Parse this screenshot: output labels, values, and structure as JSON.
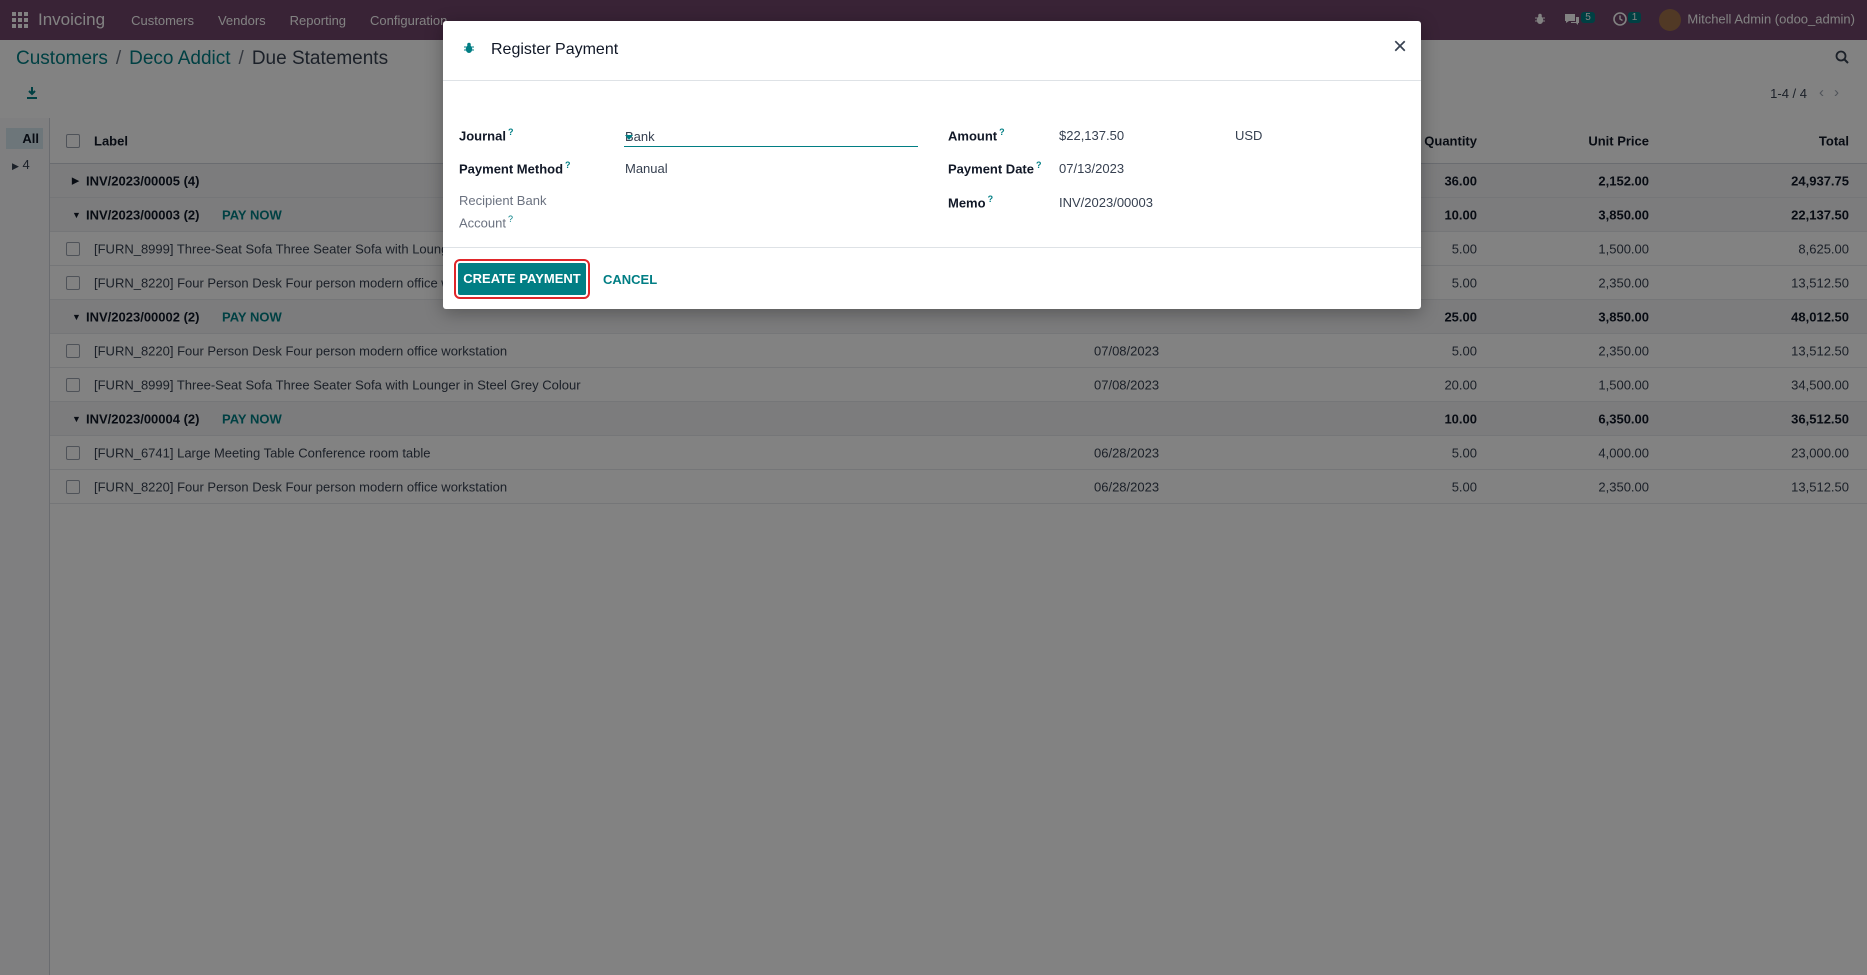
{
  "navbar": {
    "app_name": "Invoicing",
    "menu": [
      "Customers",
      "Vendors",
      "Reporting",
      "Configuration"
    ],
    "messages_count": "5",
    "activities_count": "1",
    "user": "Mitchell Admin (odoo_admin)"
  },
  "breadcrumb": {
    "items": [
      "Customers",
      "Deco Addict"
    ],
    "current": "Due Statements"
  },
  "pager": {
    "text": "1-4 / 4"
  },
  "side_panel": {
    "all_label": "All",
    "count_label": "4"
  },
  "list": {
    "headers": {
      "label": "Label",
      "quantity": "Quantity",
      "unit_price": "Unit Price",
      "total": "Total"
    },
    "rows": [
      {
        "type": "group",
        "expanded": false,
        "label": "INV/2023/00005 (4)",
        "pay": "",
        "date": "",
        "qty": "36.00",
        "unit": "2,152.00",
        "total": "24,937.75"
      },
      {
        "type": "group",
        "expanded": true,
        "label": "INV/2023/00003 (2)",
        "pay": "PAY NOW",
        "date": "",
        "qty": "10.00",
        "unit": "3,850.00",
        "total": "22,137.50"
      },
      {
        "type": "line",
        "label": "[FURN_8999] Three-Seat Sofa Three Seater Sofa with Lounger in Steel Grey Colour",
        "date": "",
        "qty": "5.00",
        "unit": "1,500.00",
        "total": "8,625.00"
      },
      {
        "type": "line",
        "label": "[FURN_8220] Four Person Desk Four person modern office workstation",
        "date": "",
        "qty": "5.00",
        "unit": "2,350.00",
        "total": "13,512.50"
      },
      {
        "type": "group",
        "expanded": true,
        "label": "INV/2023/00002 (2)",
        "pay": "PAY NOW",
        "date": "",
        "qty": "25.00",
        "unit": "3,850.00",
        "total": "48,012.50"
      },
      {
        "type": "line",
        "label": "[FURN_8220] Four Person Desk Four person modern office workstation",
        "date": "07/08/2023",
        "qty": "5.00",
        "unit": "2,350.00",
        "total": "13,512.50"
      },
      {
        "type": "line",
        "label": "[FURN_8999] Three-Seat Sofa Three Seater Sofa with Lounger in Steel Grey Colour",
        "date": "07/08/2023",
        "qty": "20.00",
        "unit": "1,500.00",
        "total": "34,500.00"
      },
      {
        "type": "group",
        "expanded": true,
        "label": "INV/2023/00004 (2)",
        "pay": "PAY NOW",
        "date": "",
        "qty": "10.00",
        "unit": "6,350.00",
        "total": "36,512.50"
      },
      {
        "type": "line",
        "label": "[FURN_6741] Large Meeting Table Conference room table",
        "date": "06/28/2023",
        "qty": "5.00",
        "unit": "4,000.00",
        "total": "23,000.00"
      },
      {
        "type": "line",
        "label": "[FURN_8220] Four Person Desk Four person modern office workstation",
        "date": "06/28/2023",
        "qty": "5.00",
        "unit": "2,350.00",
        "total": "13,512.50"
      }
    ]
  },
  "modal": {
    "title": "Register Payment",
    "journal_label": "Journal",
    "journal_value": "Bank",
    "payment_method_label": "Payment Method",
    "payment_method_value": "Manual",
    "recipient_label_1": "Recipient Bank",
    "recipient_label_2": "Account",
    "amount_label": "Amount",
    "amount_value": "$22,137.50",
    "currency": "USD",
    "payment_date_label": "Payment Date",
    "payment_date_value": "07/13/2023",
    "memo_label": "Memo",
    "memo_value": "INV/2023/00003",
    "help_mark": "?",
    "create_label": "CREATE PAYMENT",
    "cancel_label": "CANCEL"
  },
  "colors": {
    "navbar": "#71466b",
    "accent": "#017e84",
    "highlight": "#e0262a"
  }
}
